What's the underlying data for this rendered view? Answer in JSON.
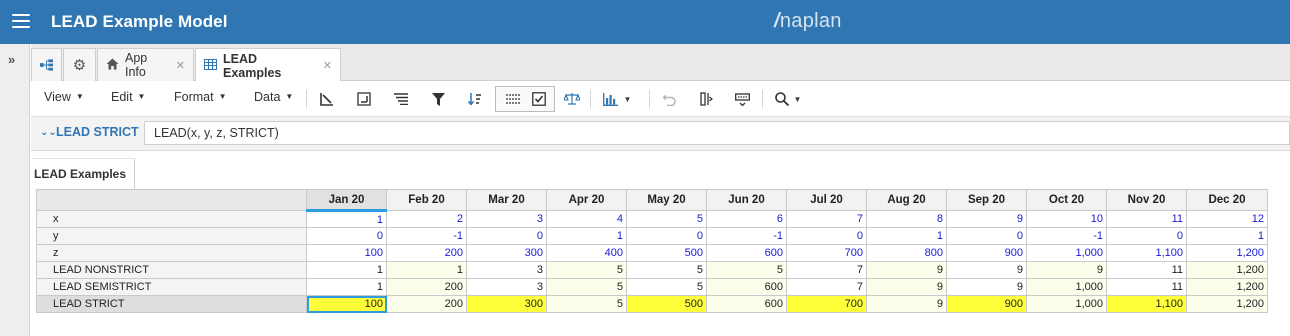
{
  "header": {
    "title": "LEAD Example Model",
    "brand_prefix": "/",
    "brand_rest": "naplan"
  },
  "tabs": [
    {
      "label": "App Info",
      "icon": "home-icon"
    },
    {
      "label": "LEAD Examples",
      "icon": "grid-icon"
    }
  ],
  "toolbar": {
    "menus": [
      "View",
      "Edit",
      "Format",
      "Data"
    ]
  },
  "formula": {
    "line_item": "LEAD STRICT",
    "expression": "LEAD(x, y, z, STRICT)"
  },
  "view": {
    "name": "LEAD Examples"
  },
  "grid": {
    "columns": [
      "Jan 20",
      "Feb 20",
      "Mar 20",
      "Apr 20",
      "May 20",
      "Jun 20",
      "Jul 20",
      "Aug 20",
      "Sep 20",
      "Oct 20",
      "Nov 20",
      "Dec 20"
    ],
    "selected_column": 0,
    "rows": [
      {
        "label": "x",
        "kind": "input",
        "cells": [
          "1",
          "2",
          "3",
          "4",
          "5",
          "6",
          "7",
          "8",
          "9",
          "10",
          "11",
          "12"
        ]
      },
      {
        "label": "y",
        "kind": "input",
        "cells": [
          "0",
          "-1",
          "0",
          "1",
          "0",
          "-1",
          "0",
          "1",
          "0",
          "-1",
          "0",
          "1"
        ]
      },
      {
        "label": "z",
        "kind": "input",
        "cells": [
          "100",
          "200",
          "300",
          "400",
          "500",
          "600",
          "700",
          "800",
          "900",
          "1,000",
          "1,100",
          "1,200"
        ]
      },
      {
        "label": "LEAD NONSTRICT",
        "kind": "calc",
        "cells": [
          "1",
          "1",
          "3",
          "5",
          "5",
          "5",
          "7",
          "9",
          "9",
          "9",
          "11",
          "1,200"
        ],
        "highlight": [
          false,
          false,
          false,
          false,
          false,
          false,
          false,
          false,
          false,
          false,
          false,
          true
        ]
      },
      {
        "label": "LEAD SEMISTRICT",
        "kind": "calc",
        "cells": [
          "1",
          "200",
          "3",
          "5",
          "5",
          "600",
          "7",
          "9",
          "9",
          "1,000",
          "11",
          "1,200"
        ],
        "highlight": [
          false,
          true,
          false,
          false,
          false,
          true,
          false,
          false,
          false,
          true,
          false,
          true
        ]
      },
      {
        "label": "LEAD STRICT",
        "kind": "calc",
        "cells": [
          "100",
          "200",
          "300",
          "5",
          "500",
          "600",
          "700",
          "9",
          "900",
          "1,000",
          "1,100",
          "1,200"
        ],
        "highlight": [
          true,
          true,
          true,
          false,
          true,
          true,
          true,
          false,
          true,
          true,
          true,
          true
        ]
      }
    ],
    "highlight_color": "#ffff3a",
    "input_color": "#1a1ad6",
    "selection_color": "#2d9ce0"
  }
}
